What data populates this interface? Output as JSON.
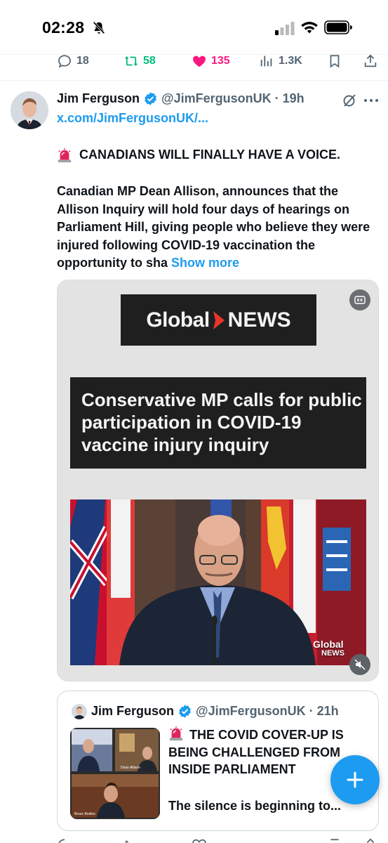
{
  "status_bar": {
    "time": "02:28",
    "icons": [
      "bell-slash-icon",
      "cellular-signal-icon",
      "wifi-icon",
      "battery-icon"
    ]
  },
  "previous_tweet_actions": {
    "replies": "18",
    "reposts": "58",
    "likes": "135",
    "views": "1.3K",
    "icons": [
      "reply-icon",
      "repost-icon",
      "heart-filled-icon",
      "views-icon",
      "bookmark-icon",
      "share-icon"
    ]
  },
  "tweet": {
    "author_name": "Jim Ferguson",
    "handle_time": "@JimFergusonUK · 19h",
    "link": "x.com/JimFergusonUK/...",
    "headline": "CANADIANS WILL FINALLY HAVE A VOICE.",
    "body": "Canadian MP Dean Allison, announces that the Allison Inquiry will hold four days of hearings on Parliament Hill, giving people who believe they were injured following COVID-19 vaccination the opportunity to sha",
    "show_more": "Show more",
    "media": {
      "logo_left": "Global",
      "logo_right": "NEWS",
      "headline": "Conservative MP calls for public participation in COVID-19 vaccine injury inquiry",
      "watermark_top": "Global",
      "watermark_bottom": "NEWS"
    }
  },
  "quoted_tweet": {
    "author_name": "Jim Ferguson",
    "handle_time": "@JimFergusonUK · 21h",
    "text": "THE COVID COVER-UP IS BEING CHALLENGED FROM INSIDE PARLIAMENT",
    "snippet": "The silence is beginning to...",
    "thumb_caption_1": "Dean Allison",
    "thumb_caption_2": "Bruce Bodine"
  },
  "colors": {
    "accent": "#1d9bf0",
    "repost": "#00ba7c",
    "like": "#f91880",
    "muted": "#536471"
  }
}
